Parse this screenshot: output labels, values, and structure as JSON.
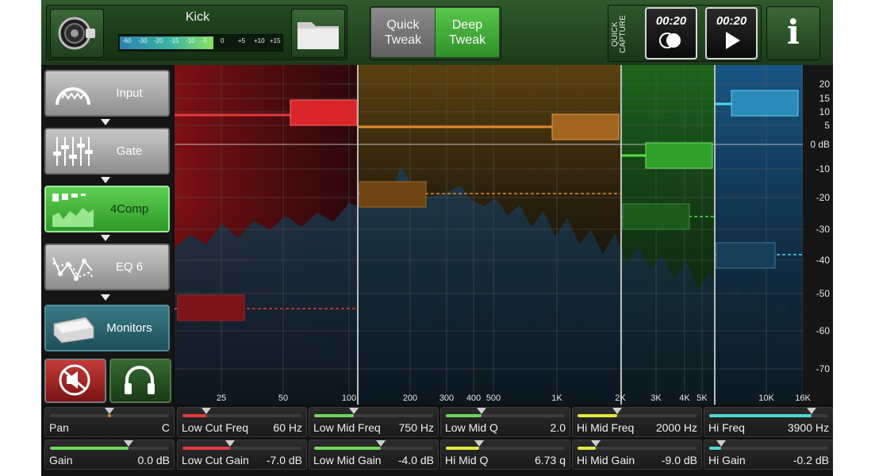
{
  "header": {
    "channel_name": "Kick",
    "meter_scale": [
      "-60",
      "-30",
      "-20",
      "-15",
      "-10",
      "-5",
      "0",
      "+5",
      "+10",
      "+15"
    ],
    "meter_level": 0.58,
    "quick_tweak_label": "Quick Tweak",
    "deep_tweak_label": "Deep Tweak",
    "quick_capture_label": "QUICK CAPTURE",
    "record_time": "00:20",
    "play_time": "00:20",
    "info_label": "i"
  },
  "sidebar": {
    "items": [
      {
        "label": "Input",
        "icon": "input-knob-icon",
        "active": false
      },
      {
        "label": "Gate",
        "icon": "gate-faders-icon",
        "active": false
      },
      {
        "label": "4Comp",
        "icon": "compressor-icon",
        "active": true
      },
      {
        "label": "EQ 6",
        "icon": "eq-curve-icon",
        "active": false
      },
      {
        "label": "Monitors",
        "icon": "monitor-wedge-icon",
        "active": false
      }
    ],
    "mute_icon": "speaker-mute-icon",
    "headphones_icon": "headphones-icon"
  },
  "graph": {
    "y_ticks": [
      "20",
      "15",
      "10",
      "5",
      "0 dB",
      "-10",
      "-20",
      "-30",
      "-40",
      "-50",
      "-60",
      "-70"
    ],
    "x_ticks": [
      "25",
      "50",
      "100",
      "200",
      "300",
      "400",
      "500",
      "1K",
      "2K",
      "3K",
      "4K",
      "5K",
      "10K",
      "16K"
    ],
    "band_colors": {
      "low_cut": "#e0262a",
      "low_mid": "#e0892a",
      "hi_mid": "#3dbb3a",
      "hi": "#2a9ad8"
    }
  },
  "controls": {
    "pan": {
      "name": "Pan",
      "value": "C",
      "level": 0.5,
      "color": "#e08a2a"
    },
    "gain": {
      "name": "Gain",
      "value": "0.0 dB",
      "level": 0.66,
      "color": "#6fd35a"
    },
    "low_cut_freq": {
      "name": "Low Cut Freq",
      "value": "60 Hz",
      "level": 0.2,
      "color": "#e43a3a"
    },
    "low_cut_gain": {
      "name": "Low Cut Gain",
      "value": "-7.0 dB",
      "level": 0.4,
      "color": "#e43a3a"
    },
    "low_mid_freq": {
      "name": "Low Mid Freq",
      "value": "750 Hz",
      "level": 0.33,
      "color": "#6fd35a"
    },
    "low_mid_gain": {
      "name": "Low Mid Gain",
      "value": "-4.0 dB",
      "level": 0.56,
      "color": "#6fd35a"
    },
    "low_mid_q": {
      "name": "Low Mid Q",
      "value": "2.0",
      "level": 0.3,
      "color": "#6fd35a"
    },
    "hi_mid_q": {
      "name": "Hi Mid Q",
      "value": "6.73 q",
      "level": 0.28,
      "color": "#e6e640"
    },
    "hi_mid_freq": {
      "name": "Hi Mid Freq",
      "value": "2000 Hz",
      "level": 0.33,
      "color": "#e6e640"
    },
    "hi_mid_gain": {
      "name": "Hi Mid Gain",
      "value": "-9.0 dB",
      "level": 0.15,
      "color": "#e6e640"
    },
    "hi_freq": {
      "name": "Hi Freq",
      "value": "3900 Hz",
      "level": 0.86,
      "color": "#4fd6d6"
    },
    "hi_gain": {
      "name": "Hi Gain",
      "value": "-0.2 dB",
      "level": 0.1,
      "color": "#4fd6d6"
    }
  }
}
